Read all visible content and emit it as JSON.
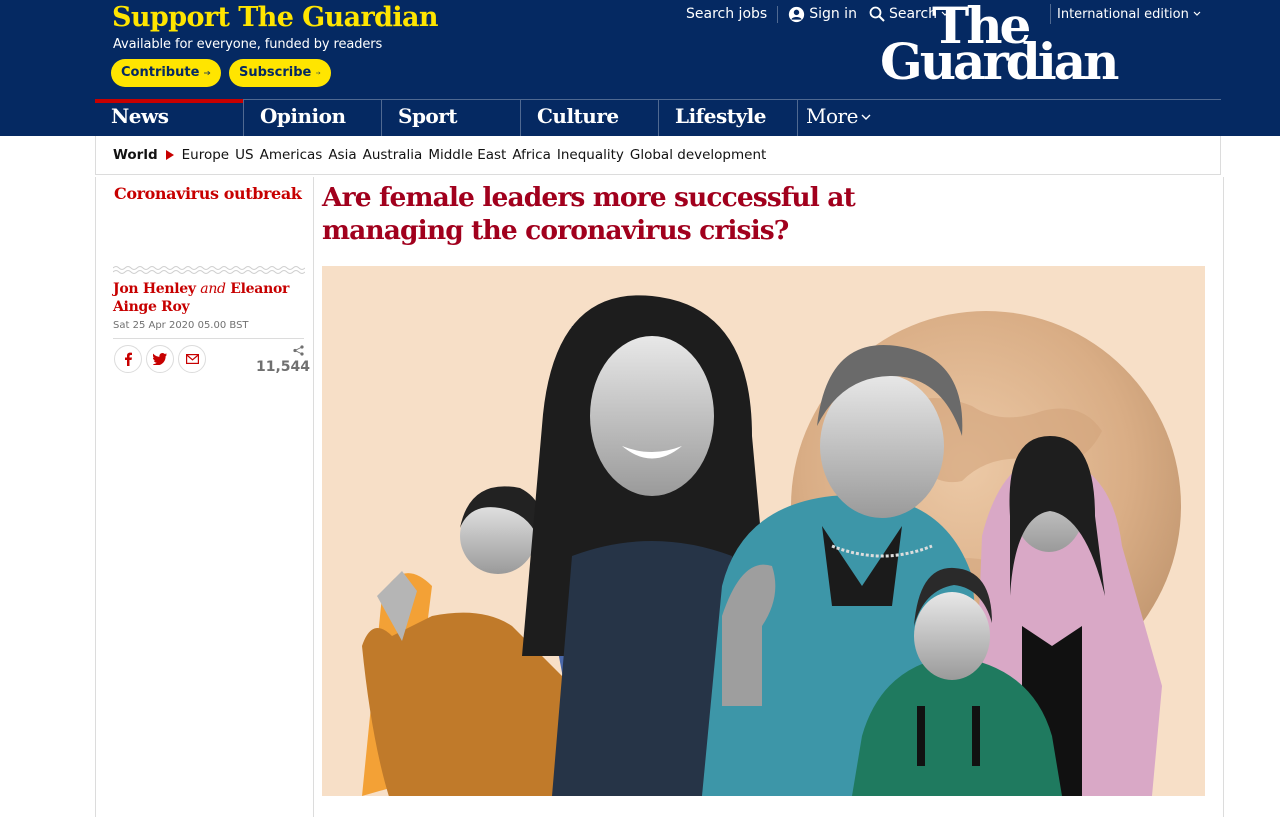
{
  "support": {
    "title": "Support The Guardian",
    "subtitle": "Available for everyone, funded by readers",
    "contribute_label": "Contribute",
    "subscribe_label": "Subscribe"
  },
  "top_links": {
    "search_jobs": "Search jobs",
    "sign_in": "Sign in",
    "search": "Search",
    "edition": "International edition"
  },
  "logo": {
    "line1": "The",
    "line2": "Guardian"
  },
  "nav": {
    "items": [
      {
        "label": "News",
        "active": true
      },
      {
        "label": "Opinion"
      },
      {
        "label": "Sport"
      },
      {
        "label": "Culture"
      },
      {
        "label": "Lifestyle"
      },
      {
        "label": "More"
      }
    ]
  },
  "subnav": {
    "current": "World",
    "items": [
      "Europe",
      "US",
      "Americas",
      "Asia",
      "Australia",
      "Middle East",
      "Africa",
      "Inequality",
      "Global development"
    ]
  },
  "article": {
    "series": "Coronavirus outbreak",
    "headline": "Are female leaders more successful at managing the coronavirus crisis?",
    "author1": "Jon Henley",
    "and": "and",
    "author2": "Eleanor Ainge Roy",
    "date": "Sat 25 Apr 2020 05.00 BST",
    "share_count": "11,544"
  },
  "colors": {
    "brand_blue": "#052962",
    "support_yellow": "#ffe500",
    "news_red": "#c70000",
    "headline_red": "#a1001d",
    "hero_background": "#f7dfc7"
  }
}
